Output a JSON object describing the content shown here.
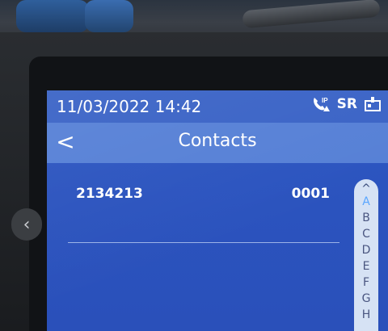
{
  "status": {
    "datetime": "11/03/2022 14:42",
    "icons": [
      "voip-icon",
      "sr-icon",
      "device-icon"
    ],
    "sr_text": "SR"
  },
  "header": {
    "back_symbol": "<",
    "title": "Contacts"
  },
  "contacts": [
    {
      "name": "2134213",
      "number": "0001"
    }
  ],
  "alphabet": {
    "up_symbol": "^",
    "letters": [
      "A",
      "B",
      "C",
      "D",
      "E",
      "F",
      "G",
      "H"
    ],
    "active": "A"
  },
  "colors": {
    "screen_bg": "#2a50ba",
    "title_bar": "#5680d6",
    "status_bar": "#3a63c6",
    "alpha_active": "#5aa6ff"
  }
}
